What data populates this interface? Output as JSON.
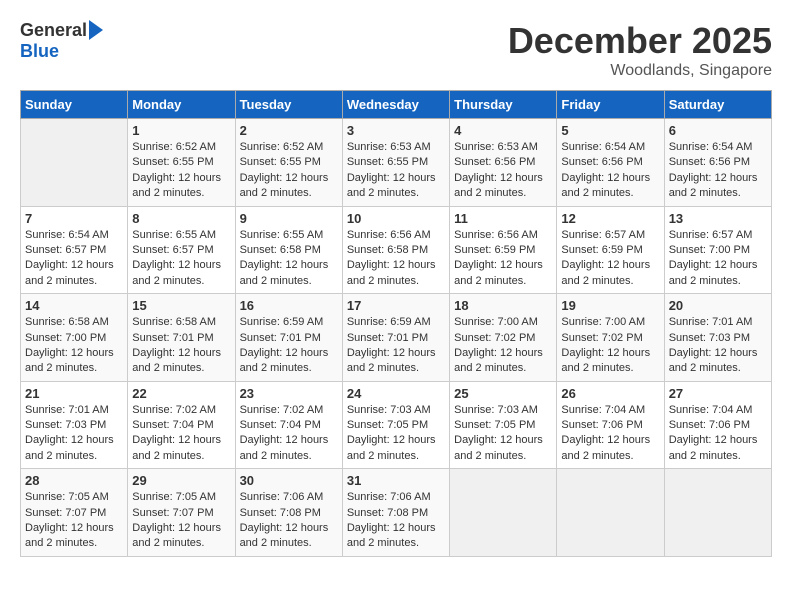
{
  "header": {
    "logo": {
      "general": "General",
      "blue": "Blue"
    },
    "title": "December 2025",
    "location": "Woodlands, Singapore"
  },
  "weekdays": [
    "Sunday",
    "Monday",
    "Tuesday",
    "Wednesday",
    "Thursday",
    "Friday",
    "Saturday"
  ],
  "weeks": [
    [
      {
        "day": "",
        "sunrise": "",
        "sunset": "",
        "daylight": "",
        "empty": true
      },
      {
        "day": "1",
        "sunrise": "Sunrise: 6:52 AM",
        "sunset": "Sunset: 6:55 PM",
        "daylight": "Daylight: 12 hours and 2 minutes."
      },
      {
        "day": "2",
        "sunrise": "Sunrise: 6:52 AM",
        "sunset": "Sunset: 6:55 PM",
        "daylight": "Daylight: 12 hours and 2 minutes."
      },
      {
        "day": "3",
        "sunrise": "Sunrise: 6:53 AM",
        "sunset": "Sunset: 6:55 PM",
        "daylight": "Daylight: 12 hours and 2 minutes."
      },
      {
        "day": "4",
        "sunrise": "Sunrise: 6:53 AM",
        "sunset": "Sunset: 6:56 PM",
        "daylight": "Daylight: 12 hours and 2 minutes."
      },
      {
        "day": "5",
        "sunrise": "Sunrise: 6:54 AM",
        "sunset": "Sunset: 6:56 PM",
        "daylight": "Daylight: 12 hours and 2 minutes."
      },
      {
        "day": "6",
        "sunrise": "Sunrise: 6:54 AM",
        "sunset": "Sunset: 6:56 PM",
        "daylight": "Daylight: 12 hours and 2 minutes."
      }
    ],
    [
      {
        "day": "7",
        "sunrise": "Sunrise: 6:54 AM",
        "sunset": "Sunset: 6:57 PM",
        "daylight": "Daylight: 12 hours and 2 minutes."
      },
      {
        "day": "8",
        "sunrise": "Sunrise: 6:55 AM",
        "sunset": "Sunset: 6:57 PM",
        "daylight": "Daylight: 12 hours and 2 minutes."
      },
      {
        "day": "9",
        "sunrise": "Sunrise: 6:55 AM",
        "sunset": "Sunset: 6:58 PM",
        "daylight": "Daylight: 12 hours and 2 minutes."
      },
      {
        "day": "10",
        "sunrise": "Sunrise: 6:56 AM",
        "sunset": "Sunset: 6:58 PM",
        "daylight": "Daylight: 12 hours and 2 minutes."
      },
      {
        "day": "11",
        "sunrise": "Sunrise: 6:56 AM",
        "sunset": "Sunset: 6:59 PM",
        "daylight": "Daylight: 12 hours and 2 minutes."
      },
      {
        "day": "12",
        "sunrise": "Sunrise: 6:57 AM",
        "sunset": "Sunset: 6:59 PM",
        "daylight": "Daylight: 12 hours and 2 minutes."
      },
      {
        "day": "13",
        "sunrise": "Sunrise: 6:57 AM",
        "sunset": "Sunset: 7:00 PM",
        "daylight": "Daylight: 12 hours and 2 minutes."
      }
    ],
    [
      {
        "day": "14",
        "sunrise": "Sunrise: 6:58 AM",
        "sunset": "Sunset: 7:00 PM",
        "daylight": "Daylight: 12 hours and 2 minutes."
      },
      {
        "day": "15",
        "sunrise": "Sunrise: 6:58 AM",
        "sunset": "Sunset: 7:01 PM",
        "daylight": "Daylight: 12 hours and 2 minutes."
      },
      {
        "day": "16",
        "sunrise": "Sunrise: 6:59 AM",
        "sunset": "Sunset: 7:01 PM",
        "daylight": "Daylight: 12 hours and 2 minutes."
      },
      {
        "day": "17",
        "sunrise": "Sunrise: 6:59 AM",
        "sunset": "Sunset: 7:01 PM",
        "daylight": "Daylight: 12 hours and 2 minutes."
      },
      {
        "day": "18",
        "sunrise": "Sunrise: 7:00 AM",
        "sunset": "Sunset: 7:02 PM",
        "daylight": "Daylight: 12 hours and 2 minutes."
      },
      {
        "day": "19",
        "sunrise": "Sunrise: 7:00 AM",
        "sunset": "Sunset: 7:02 PM",
        "daylight": "Daylight: 12 hours and 2 minutes."
      },
      {
        "day": "20",
        "sunrise": "Sunrise: 7:01 AM",
        "sunset": "Sunset: 7:03 PM",
        "daylight": "Daylight: 12 hours and 2 minutes."
      }
    ],
    [
      {
        "day": "21",
        "sunrise": "Sunrise: 7:01 AM",
        "sunset": "Sunset: 7:03 PM",
        "daylight": "Daylight: 12 hours and 2 minutes."
      },
      {
        "day": "22",
        "sunrise": "Sunrise: 7:02 AM",
        "sunset": "Sunset: 7:04 PM",
        "daylight": "Daylight: 12 hours and 2 minutes."
      },
      {
        "day": "23",
        "sunrise": "Sunrise: 7:02 AM",
        "sunset": "Sunset: 7:04 PM",
        "daylight": "Daylight: 12 hours and 2 minutes."
      },
      {
        "day": "24",
        "sunrise": "Sunrise: 7:03 AM",
        "sunset": "Sunset: 7:05 PM",
        "daylight": "Daylight: 12 hours and 2 minutes."
      },
      {
        "day": "25",
        "sunrise": "Sunrise: 7:03 AM",
        "sunset": "Sunset: 7:05 PM",
        "daylight": "Daylight: 12 hours and 2 minutes."
      },
      {
        "day": "26",
        "sunrise": "Sunrise: 7:04 AM",
        "sunset": "Sunset: 7:06 PM",
        "daylight": "Daylight: 12 hours and 2 minutes."
      },
      {
        "day": "27",
        "sunrise": "Sunrise: 7:04 AM",
        "sunset": "Sunset: 7:06 PM",
        "daylight": "Daylight: 12 hours and 2 minutes."
      }
    ],
    [
      {
        "day": "28",
        "sunrise": "Sunrise: 7:05 AM",
        "sunset": "Sunset: 7:07 PM",
        "daylight": "Daylight: 12 hours and 2 minutes."
      },
      {
        "day": "29",
        "sunrise": "Sunrise: 7:05 AM",
        "sunset": "Sunset: 7:07 PM",
        "daylight": "Daylight: 12 hours and 2 minutes."
      },
      {
        "day": "30",
        "sunrise": "Sunrise: 7:06 AM",
        "sunset": "Sunset: 7:08 PM",
        "daylight": "Daylight: 12 hours and 2 minutes."
      },
      {
        "day": "31",
        "sunrise": "Sunrise: 7:06 AM",
        "sunset": "Sunset: 7:08 PM",
        "daylight": "Daylight: 12 hours and 2 minutes."
      },
      {
        "day": "",
        "sunrise": "",
        "sunset": "",
        "daylight": "",
        "empty": true
      },
      {
        "day": "",
        "sunrise": "",
        "sunset": "",
        "daylight": "",
        "empty": true
      },
      {
        "day": "",
        "sunrise": "",
        "sunset": "",
        "daylight": "",
        "empty": true
      }
    ]
  ]
}
